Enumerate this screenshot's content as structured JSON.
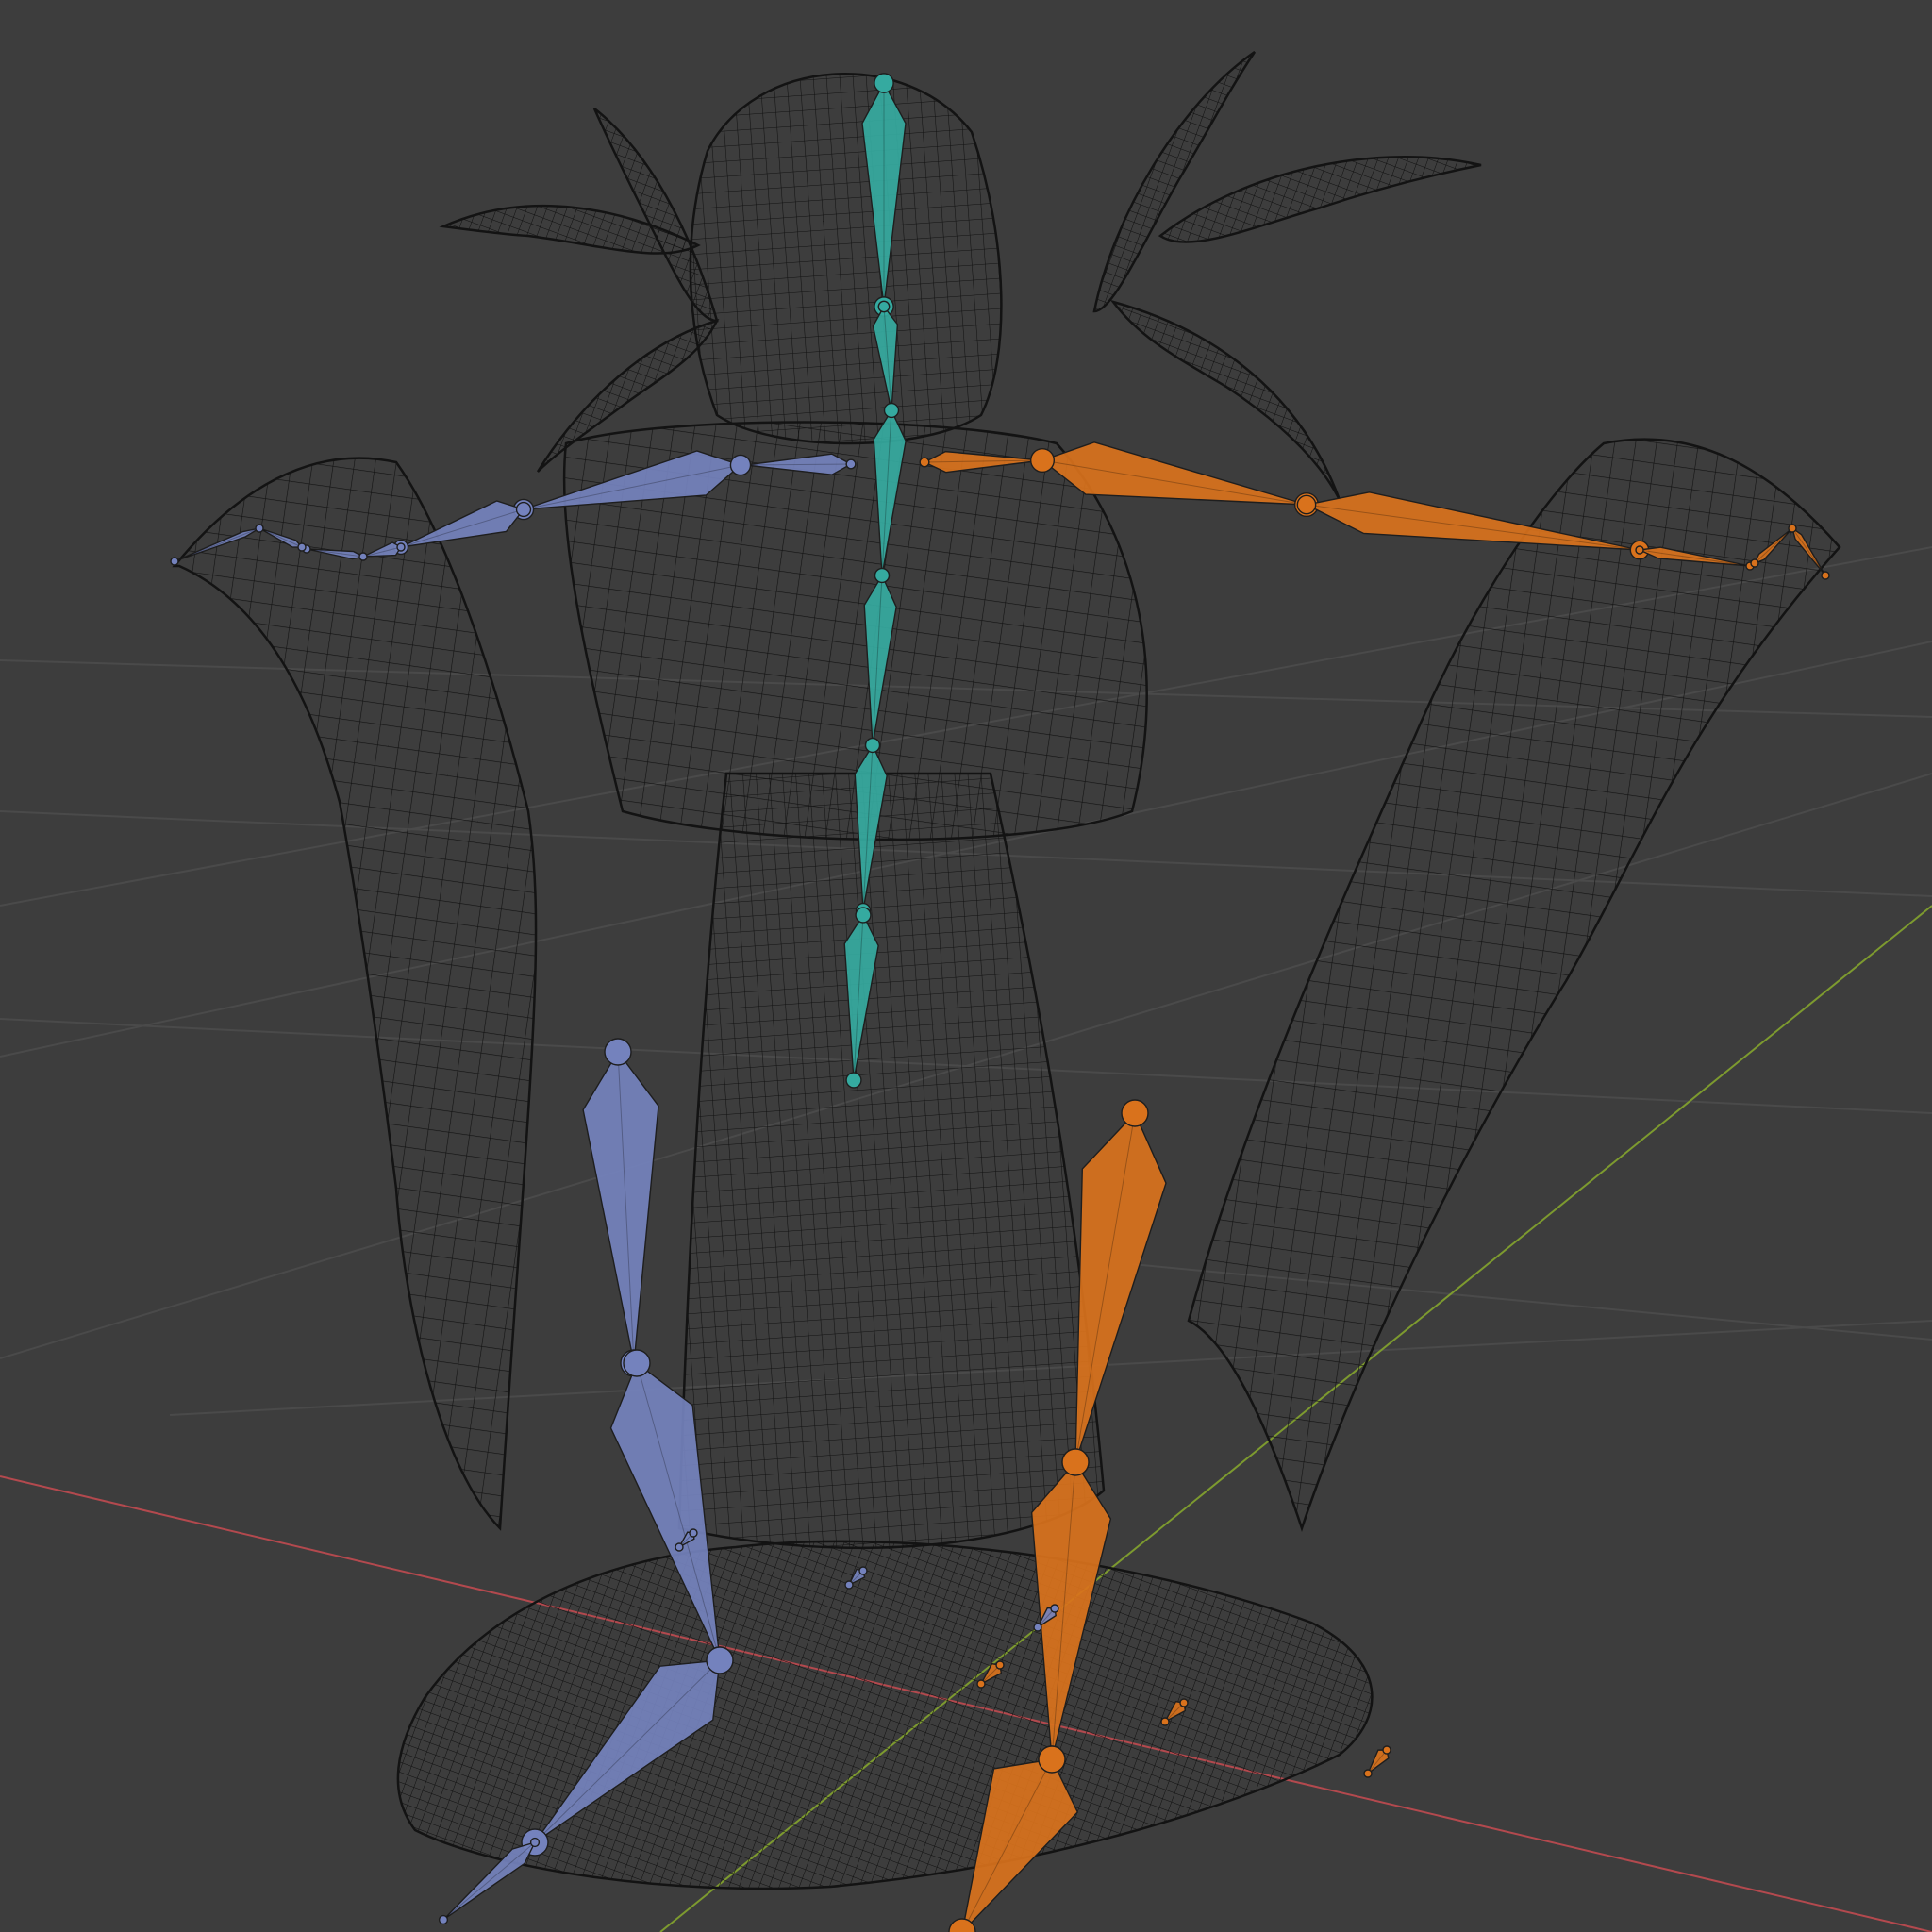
{
  "viewport": {
    "name": "3D Viewport",
    "mode": "wireframe",
    "background_color": "#3d3d3d"
  },
  "colors": {
    "grid": "#4b4b4b",
    "x_axis": "#b3494e",
    "y_axis": "#7d9a2f",
    "wire": "#111111",
    "bone_center": "#35aaa0",
    "bone_left": "#7482bd",
    "bone_right": "#d9721c"
  },
  "armature": {
    "bone_groups": [
      "center",
      "left",
      "right"
    ]
  }
}
